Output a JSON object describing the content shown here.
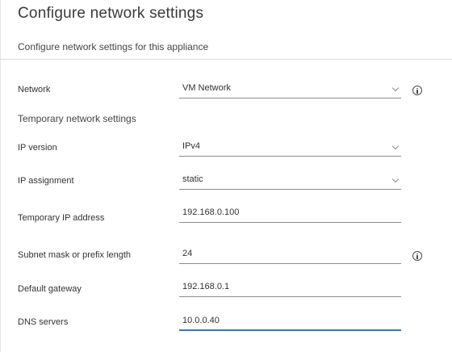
{
  "header": {
    "title": "Configure network settings",
    "subtitle": "Configure network settings for this appliance"
  },
  "section": {
    "heading": "Temporary network settings"
  },
  "fields": {
    "network": {
      "label": "Network",
      "value": "VM Network",
      "type": "select",
      "info_icon": "info-icon"
    },
    "ip_version": {
      "label": "IP version",
      "value": "IPv4",
      "type": "select"
    },
    "ip_assignment": {
      "label": "IP assignment",
      "value": "static",
      "type": "select"
    },
    "temp_ip": {
      "label": "Temporary IP address",
      "value": "192.168.0.100",
      "type": "text"
    },
    "subnet": {
      "label": "Subnet mask or prefix length",
      "value": "24",
      "type": "text",
      "info_icon": "info-icon"
    },
    "gateway": {
      "label": "Default gateway",
      "value": "192.168.0.1",
      "type": "text"
    },
    "dns": {
      "label": "DNS servers",
      "value": "10.0.0.40",
      "type": "text",
      "focused": true
    }
  },
  "colors": {
    "focus_accent": "#2d79c7",
    "underline": "#8c8c8c",
    "text": "#313131"
  }
}
